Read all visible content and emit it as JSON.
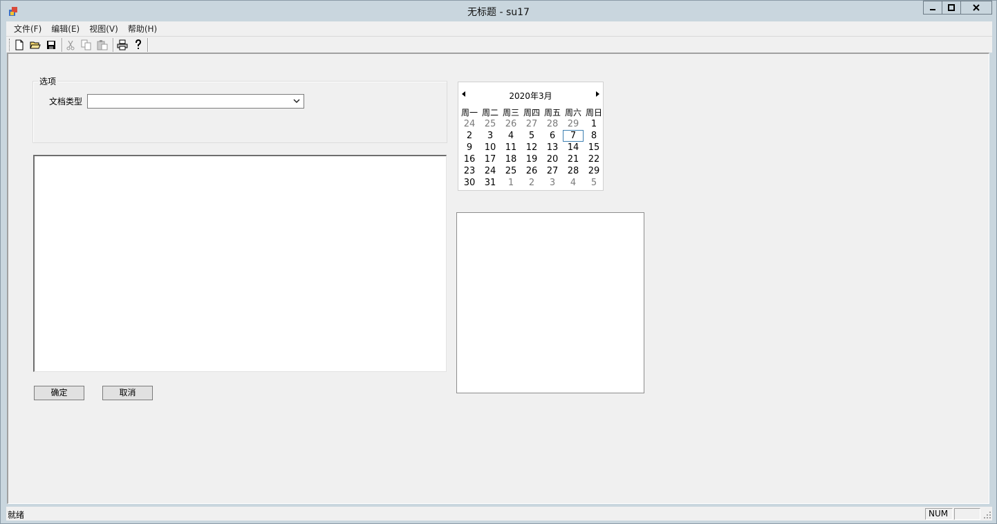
{
  "window": {
    "title": "无标题 - su17"
  },
  "menubar": {
    "items": [
      "文件(F)",
      "编辑(E)",
      "视图(V)",
      "帮助(H)"
    ]
  },
  "toolbar": {
    "icons": [
      "new-file-icon",
      "open-folder-icon",
      "save-icon",
      "cut-icon",
      "copy-icon",
      "paste-icon",
      "print-icon",
      "help-icon"
    ]
  },
  "options": {
    "group_label": "选项",
    "doc_type_label": "文档类型",
    "doc_type_value": ""
  },
  "buttons": {
    "ok": "确定",
    "cancel": "取消"
  },
  "calendar": {
    "title": "2020年3月",
    "weekdays": [
      "周一",
      "周二",
      "周三",
      "周四",
      "周五",
      "周六",
      "周日"
    ],
    "weeks": [
      [
        "24",
        "25",
        "26",
        "27",
        "28",
        "29",
        "1"
      ],
      [
        "2",
        "3",
        "4",
        "5",
        "6",
        "7",
        "8"
      ],
      [
        "9",
        "10",
        "11",
        "12",
        "13",
        "14",
        "15"
      ],
      [
        "16",
        "17",
        "18",
        "19",
        "20",
        "21",
        "22"
      ],
      [
        "23",
        "24",
        "25",
        "26",
        "27",
        "28",
        "29"
      ],
      [
        "30",
        "31",
        "1",
        "2",
        "3",
        "4",
        "5"
      ]
    ],
    "selected_day": "7"
  },
  "statusbar": {
    "text": "就绪",
    "num": "NUM"
  }
}
